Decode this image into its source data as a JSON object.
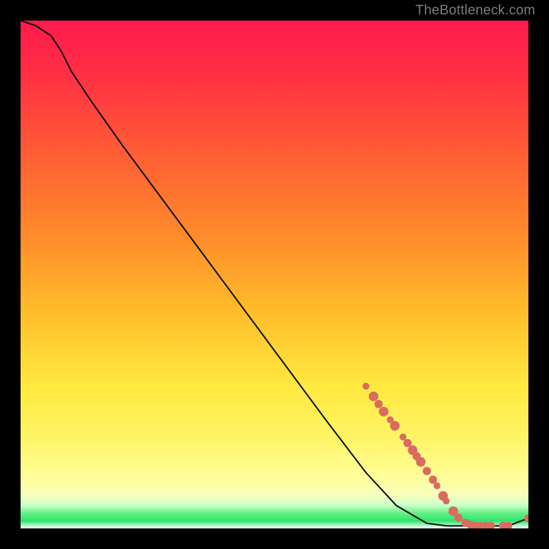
{
  "attribution": "TheBottleneck.com",
  "colors": {
    "page_bg": "#000000",
    "attribution_text": "#7b7b7b",
    "curve_stroke": "#141414",
    "dot_fill": "#d96b61",
    "gradient_top": "#ff1a4d",
    "gradient_mid_red": "#ff3b3b",
    "gradient_orange": "#ff8a2b",
    "gradient_yellow": "#ffe940",
    "gradient_pale_yellow": "#fffd8a",
    "gradient_green": "#2ee66b",
    "gradient_bottom": "#ffffff"
  },
  "chart_data": {
    "type": "line",
    "title": "",
    "xlabel": "",
    "ylabel": "",
    "xlim": [
      0,
      100
    ],
    "ylim": [
      0,
      100
    ],
    "series": [
      {
        "name": "bottleneck-curve",
        "x": [
          0,
          3,
          6,
          8,
          10,
          14,
          20,
          30,
          40,
          50,
          60,
          68,
          74,
          80,
          84,
          88,
          92,
          96,
          100
        ],
        "y": [
          100,
          99,
          97,
          94,
          90,
          84,
          75.5,
          62,
          48.5,
          35,
          21.5,
          11,
          4.5,
          1,
          0.5,
          0.5,
          0.5,
          0.5,
          2
        ]
      }
    ],
    "markers": [
      {
        "x": 68.0,
        "y": 28.0,
        "r": 5
      },
      {
        "x": 69.5,
        "y": 26.0,
        "r": 7
      },
      {
        "x": 70.5,
        "y": 24.5,
        "r": 6
      },
      {
        "x": 71.5,
        "y": 23.0,
        "r": 7
      },
      {
        "x": 72.8,
        "y": 21.4,
        "r": 5
      },
      {
        "x": 73.7,
        "y": 20.2,
        "r": 7
      },
      {
        "x": 75.3,
        "y": 18.0,
        "r": 5
      },
      {
        "x": 76.2,
        "y": 16.8,
        "r": 6
      },
      {
        "x": 77.2,
        "y": 15.4,
        "r": 7
      },
      {
        "x": 78.0,
        "y": 14.2,
        "r": 6
      },
      {
        "x": 78.8,
        "y": 13.1,
        "r": 7
      },
      {
        "x": 80.0,
        "y": 11.3,
        "r": 6
      },
      {
        "x": 81.2,
        "y": 9.6,
        "r": 6
      },
      {
        "x": 82.0,
        "y": 8.4,
        "r": 5
      },
      {
        "x": 83.2,
        "y": 6.4,
        "r": 7
      },
      {
        "x": 83.8,
        "y": 5.4,
        "r": 5
      },
      {
        "x": 85.2,
        "y": 3.4,
        "r": 7
      },
      {
        "x": 86.2,
        "y": 2.1,
        "r": 6
      },
      {
        "x": 87.6,
        "y": 1.1,
        "r": 6
      },
      {
        "x": 88.6,
        "y": 0.7,
        "r": 6
      },
      {
        "x": 89.6,
        "y": 0.5,
        "r": 6
      },
      {
        "x": 90.6,
        "y": 0.5,
        "r": 6
      },
      {
        "x": 91.6,
        "y": 0.5,
        "r": 6
      },
      {
        "x": 92.6,
        "y": 0.5,
        "r": 6
      },
      {
        "x": 95.0,
        "y": 0.5,
        "r": 6
      },
      {
        "x": 96.0,
        "y": 0.5,
        "r": 6
      },
      {
        "x": 100.0,
        "y": 2.0,
        "r": 6
      }
    ]
  }
}
